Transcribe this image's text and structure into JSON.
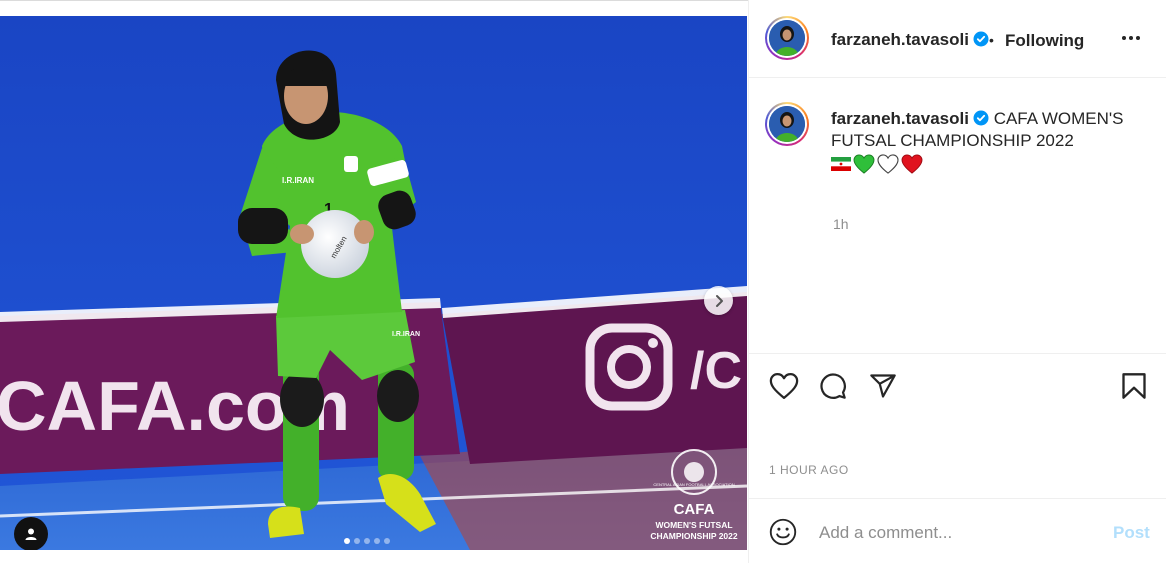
{
  "post": {
    "author": "farzaneh.tavasoli",
    "separator": "•",
    "follow_state": "Following",
    "caption": "CAFA WOMEN'S FUTSAL CHAMPIONSHIP 2022",
    "caption_emojis": [
      "iran-flag",
      "green-heart",
      "white-heart",
      "red-heart"
    ],
    "time_ago": "1h",
    "timestamp": "1 HOUR AGO",
    "carousel": {
      "slide_count": 5,
      "active_index": 1
    }
  },
  "photo": {
    "banner_left_text": "CAFA.com",
    "banner_right_text": "/C",
    "player_chest_text": "I.R.IRAN",
    "player_shorts_text": "I.R.IRAN",
    "player_number": "1",
    "ball_text": "molten",
    "logo_title": "CAFA",
    "logo_line1": "WOMEN'S FUTSAL",
    "logo_line2": "CHAMPIONSHIP 2022",
    "logo_sub": "CENTRAL ASIAN FOOTBALL ASSOCIATION"
  },
  "comment": {
    "placeholder": "Add a comment...",
    "post_label": "Post"
  },
  "colors": {
    "accent_blue": "#0095f6",
    "post_disabled": "#b2dffc",
    "muted": "#8e8e8e",
    "court_blue": "#1f4fc9",
    "banner_magenta": "#6b1a5b"
  }
}
